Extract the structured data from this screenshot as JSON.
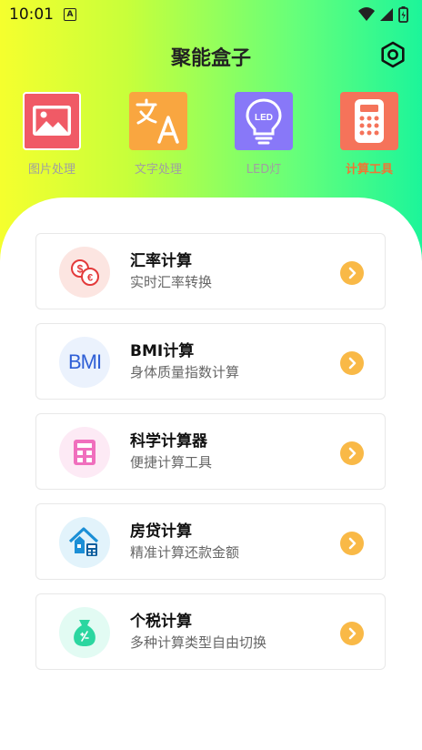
{
  "status": {
    "time": "10:01",
    "notif": "A"
  },
  "header": {
    "title": "聚能盒子"
  },
  "tools": [
    {
      "label": "图片处理",
      "icon": "image-icon",
      "color": "#f05a66"
    },
    {
      "label": "文字处理",
      "icon": "translate-icon",
      "color": "#f9a640"
    },
    {
      "label": "LED灯",
      "icon": "bulb-icon",
      "color": "#8878f8"
    },
    {
      "label": "计算工具",
      "icon": "calculator-icon",
      "color": "#f5735a"
    }
  ],
  "led_text": "LED",
  "bmi_icon_text": "BMI",
  "cards": [
    {
      "title": "汇率计算",
      "subtitle": "实时汇率转换",
      "icon": "currency-exchange-icon"
    },
    {
      "title": "BMI计算",
      "subtitle": "身体质量指数计算",
      "icon": "bmi-icon"
    },
    {
      "title": "科学计算器",
      "subtitle": "便捷计算工具",
      "icon": "scientific-calculator-icon"
    },
    {
      "title": "房贷计算",
      "subtitle": "精准计算还款金额",
      "icon": "house-loan-icon"
    },
    {
      "title": "个税计算",
      "subtitle": "多种计算类型自由切换",
      "icon": "tax-bag-icon"
    }
  ],
  "colors": {
    "accent": "#f07534",
    "arrow": "#f9b947"
  }
}
